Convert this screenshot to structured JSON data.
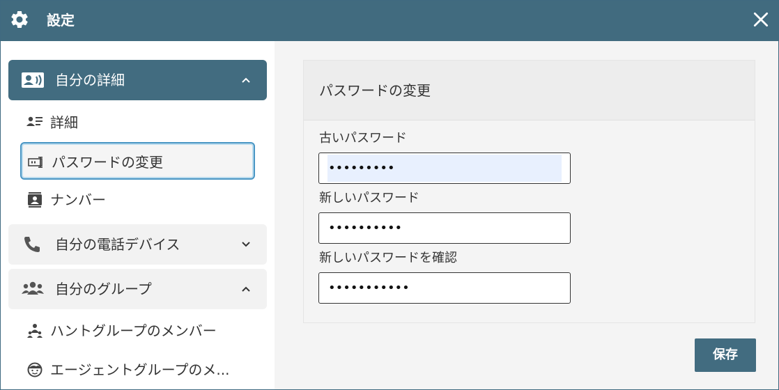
{
  "window": {
    "title": "設定",
    "accent_color": "#416b7f",
    "icons": {
      "settings": "gear-icon",
      "close": "close-icon"
    }
  },
  "sidebar": {
    "groups": [
      {
        "label": "自分の詳細",
        "icon": "contact-card-icon",
        "expanded": true,
        "active": true,
        "items": [
          {
            "label": "詳細",
            "icon": "person-details-icon",
            "selected": false
          },
          {
            "label": "パスワードの変更",
            "icon": "password-field-icon",
            "selected": true
          },
          {
            "label": "ナンバー",
            "icon": "number-badge-icon",
            "selected": false
          }
        ]
      },
      {
        "label": "自分の電話デバイス",
        "icon": "phone-icon",
        "expanded": false,
        "active": false,
        "items": []
      },
      {
        "label": "自分のグループ",
        "icon": "group-icon",
        "expanded": true,
        "active": false,
        "items": [
          {
            "label": "ハントグループのメンバー",
            "icon": "hunt-group-icon",
            "selected": false
          },
          {
            "label": "エージェントグループのメ...",
            "icon": "agent-icon",
            "selected": false
          }
        ]
      }
    ]
  },
  "main": {
    "card_title": "パスワードの変更",
    "fields": [
      {
        "label": "古いパスワード",
        "value": "•••••••••",
        "autofilled": true
      },
      {
        "label": "新しいパスワード",
        "value": "••••••••••",
        "autofilled": false
      },
      {
        "label": "新しいパスワードを確認",
        "value": "•••••••••••",
        "autofilled": false
      }
    ],
    "save_label": "保存"
  }
}
